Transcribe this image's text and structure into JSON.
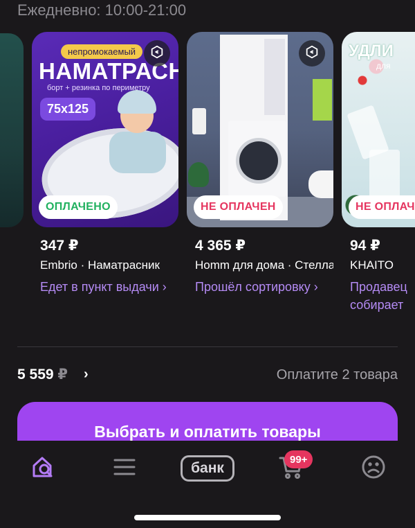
{
  "store_hours": "Ежедневно: 10:00-21:00",
  "products": [
    {
      "price": "347 ₽",
      "name": "Embrio · Наматрасник",
      "status": "Едет в пункт выдачи ›",
      "badge": "ОПЛАЧЕНО",
      "image_text": {
        "tag": "непромокаемый",
        "title": "НАМАТРАСНИК",
        "subtitle": "борт + резинка по периметру",
        "size": "75х125"
      }
    },
    {
      "price": "4 365 ₽",
      "name": "Homm для дома · Стеллаж",
      "status": "Прошёл сортировку ›",
      "badge": "НЕ ОПЛАЧЕН"
    },
    {
      "price": "94 ₽",
      "name": "KHAITO",
      "status": "Продавец собирает заказ ›",
      "badge": "НЕ ОПЛАЧЕН",
      "image_text": {
        "title": "УДЛИ",
        "subtitle": "для"
      }
    }
  ],
  "summary": {
    "total_amount": "5 559",
    "total_currency": "₽",
    "chevron": "›",
    "pay_hint": "Оплатите 2 товара"
  },
  "cta": {
    "label": "Выбрать и оплатить товары"
  },
  "tabbar": {
    "bank_label": "банк",
    "cart_badge": "99+"
  },
  "colors": {
    "background": "#1a181b",
    "accent": "#9f45f0",
    "link": "#b58bf5",
    "paid": "#21b15f",
    "unpaid": "#e5355f"
  },
  "icons": [
    "share-icon",
    "home-search-icon",
    "menu-icon",
    "cart-icon",
    "profile-icon"
  ]
}
